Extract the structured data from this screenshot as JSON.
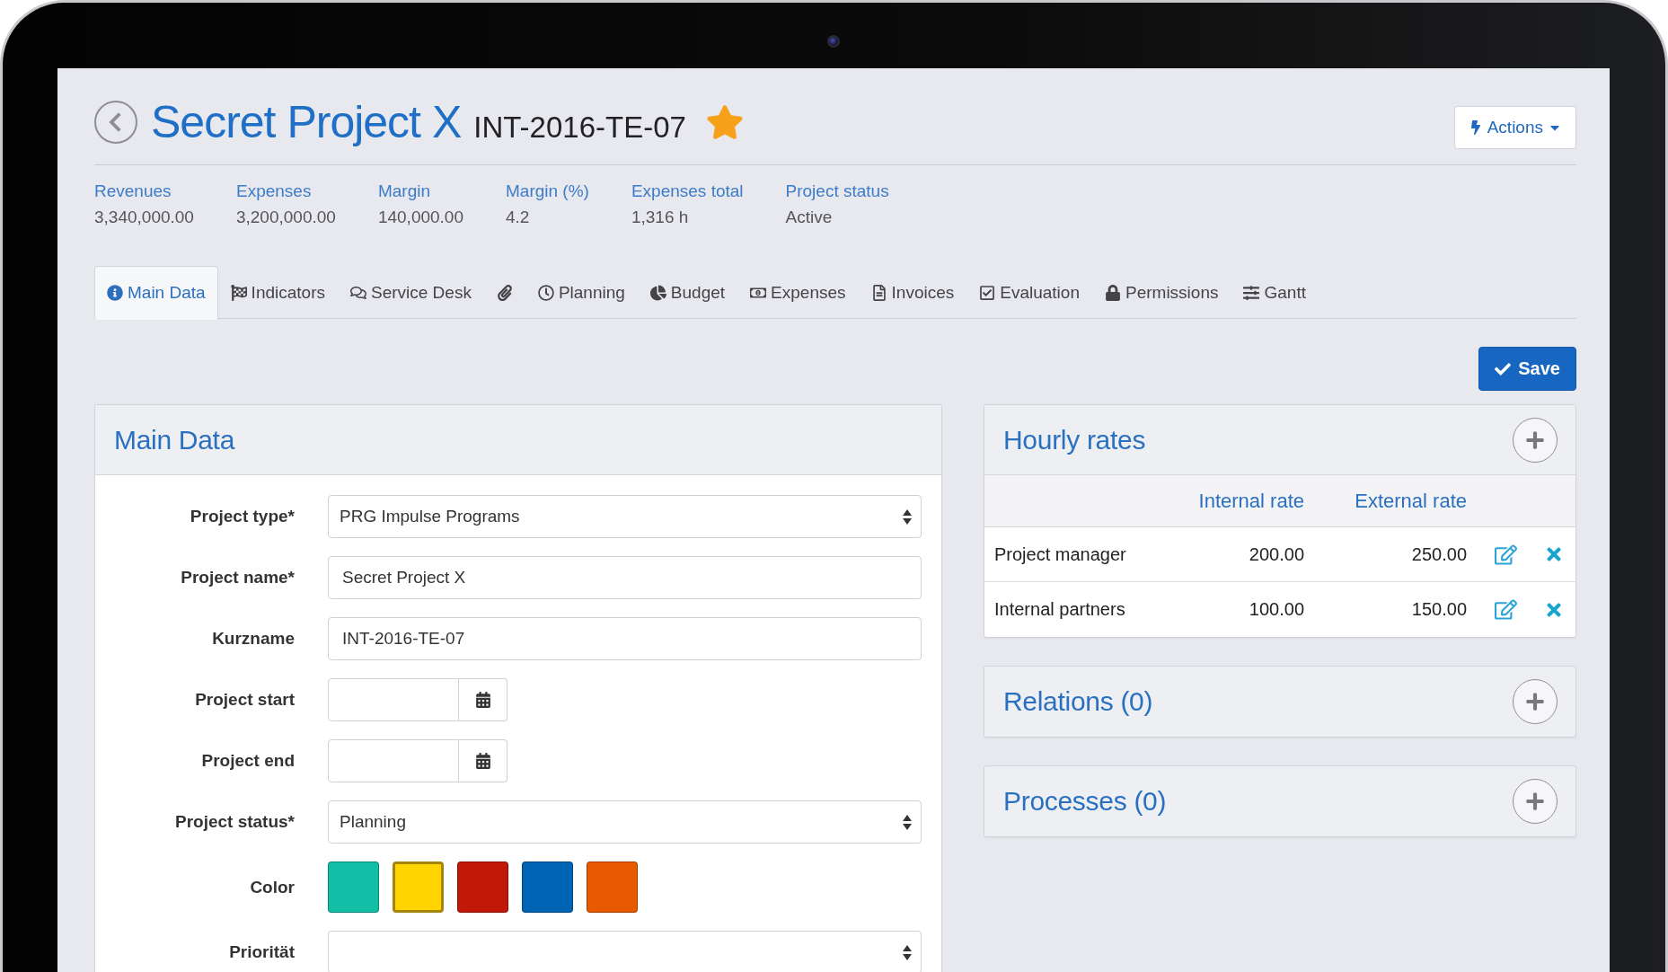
{
  "header": {
    "title": "Secret Project X",
    "code": "INT-2016-TE-07",
    "favorite": true,
    "actions": "Actions"
  },
  "stats": [
    {
      "label": "Revenues",
      "value": "3,340,000.00"
    },
    {
      "label": "Expenses",
      "value": "3,200,000.00"
    },
    {
      "label": "Margin",
      "value": "140,000.00"
    },
    {
      "label": "Margin (%)",
      "value": "4.2"
    },
    {
      "label": "Expenses total",
      "value": "1,316 h"
    },
    {
      "label": "Project status",
      "value": "Active"
    }
  ],
  "tabs": [
    {
      "label": "Main Data",
      "selected": true
    },
    {
      "label": "Indicators",
      "selected": false
    },
    {
      "label": "Service Desk",
      "selected": false
    },
    {
      "selected": false
    },
    {
      "label": "Planning",
      "selected": false
    },
    {
      "label": "Budget",
      "selected": false
    },
    {
      "label": "Expenses",
      "selected": false
    },
    {
      "label": "Invoices",
      "selected": false
    },
    {
      "label": "Evaluation",
      "selected": false
    },
    {
      "label": "Permissions",
      "selected": false
    },
    {
      "label": "Gantt",
      "selected": false
    }
  ],
  "save_button": "Save",
  "main_data": {
    "title": "Main Data",
    "fields": [
      {
        "kind": "select",
        "label": "Project type*",
        "value": "PRG Impulse Programs"
      },
      {
        "kind": "text",
        "label": "Project name*",
        "value": "Secret Project X"
      },
      {
        "kind": "text",
        "label": "Kurzname",
        "value": "INT-2016-TE-07"
      },
      {
        "kind": "date",
        "label": "Project start"
      },
      {
        "kind": "date",
        "label": "Project end"
      },
      {
        "kind": "select",
        "label": "Project status*",
        "value": "Planning"
      },
      {
        "kind": "colors",
        "label": "Color",
        "colors": [
          {
            "color": "#12bfa6",
            "selected": false
          },
          {
            "color": "#ffd400",
            "selected": true
          },
          {
            "color": "#c0190a",
            "selected": false
          },
          {
            "color": "#0064b4",
            "selected": false
          },
          {
            "color": "#e85a00",
            "selected": false
          }
        ]
      },
      {
        "kind": "select",
        "label": "Priorität"
      }
    ]
  },
  "hourly_rates": {
    "title": "Hourly rates",
    "columns": [
      "Internal rate",
      "External rate"
    ],
    "rows": [
      {
        "role": "Project manager",
        "internal_rate": "200.00",
        "external_rate": "250.00"
      },
      {
        "role": "Internal partners",
        "internal_rate": "100.00",
        "external_rate": "150.00"
      }
    ]
  },
  "relations": {
    "title": "Relations (0)"
  },
  "processes": {
    "title": "Processes (0)"
  }
}
